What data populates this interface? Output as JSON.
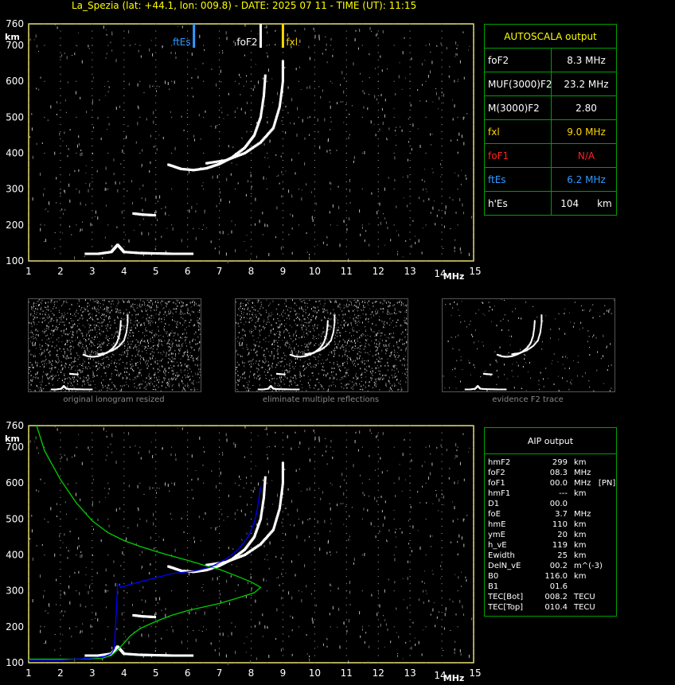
{
  "header": "La_Spezia (lat: +44.1, lon: 009.8) - DATE: 2025 07 11 - TIME (UT): 11:15",
  "autoscala": {
    "title": "AUTOSCALA output",
    "rows": [
      {
        "label": "foF2",
        "value": "8.3 MHz",
        "color": "#ffffff"
      },
      {
        "label": "MUF(3000)F2",
        "value": "23.2 MHz",
        "color": "#ffffff"
      },
      {
        "label": "M(3000)F2",
        "value": "2.80",
        "color": "#ffffff"
      },
      {
        "label": "fxl",
        "value": "9.0 MHz",
        "color": "#ffd700"
      },
      {
        "label": "foF1",
        "value": "N/A",
        "color": "#ff2020"
      },
      {
        "label": "ftEs",
        "value": "6.2 MHz",
        "color": "#3399ff"
      },
      {
        "label": "h'Es",
        "value": "104",
        "unit": "km",
        "color": "#ffffff"
      }
    ]
  },
  "aip": {
    "title": "AIP output",
    "rows": [
      [
        "hmF2",
        "299",
        "km"
      ],
      [
        "foF2",
        "08.3",
        "MHz"
      ],
      [
        "foF1",
        "00.0",
        "MHz   [PN]"
      ],
      [
        "hmF1",
        "---",
        "km"
      ],
      [
        "D1",
        "00.0",
        ""
      ],
      [
        "foE",
        "3.7",
        "MHz"
      ],
      [
        "hmE",
        "110",
        "km"
      ],
      [
        "ymE",
        "20",
        "km"
      ],
      [
        "h_vE",
        "119",
        "km"
      ],
      [
        "Ewidth",
        "25",
        "km"
      ],
      [
        "DelN_vE",
        "00.2",
        "m^(-3)"
      ],
      [
        "B0",
        "116.0",
        "km"
      ],
      [
        "B1",
        "01.6",
        ""
      ],
      [
        "TEC[Bot]",
        "008.2",
        "TECU"
      ],
      [
        "TEC[Top]",
        "010.4",
        "TECU"
      ]
    ]
  },
  "thumbnails": [
    "original ionogram resized",
    "eliminate multiple reflections",
    "evidence F2 trace"
  ],
  "chart_data": [
    {
      "type": "scatter",
      "title": "",
      "xlabel": "MHz",
      "ylabel": "km",
      "xlim": [
        1,
        15
      ],
      "ylim": [
        100,
        760
      ],
      "xticks": [
        1,
        2,
        3,
        4,
        5,
        6,
        7,
        8,
        9,
        10,
        11,
        12,
        13,
        14,
        15
      ],
      "yticks": [
        100,
        200,
        300,
        400,
        500,
        600,
        700,
        760
      ],
      "markers": [
        {
          "name": "ftEs",
          "x": 6.2,
          "color": "#3399ff"
        },
        {
          "name": "foF2",
          "x": 8.3,
          "color": "#ffffff"
        },
        {
          "name": "fxl",
          "x": 9.0,
          "color": "#ffd700"
        }
      ],
      "series": [
        {
          "color": "#ffffff",
          "points": [
            [
              2.8,
              120
            ],
            [
              3.2,
              120
            ],
            [
              3.6,
              125
            ],
            [
              3.8,
              145
            ],
            [
              4.0,
              125
            ],
            [
              4.5,
              122
            ],
            [
              5.0,
              121
            ],
            [
              5.5,
              120
            ],
            [
              6.2,
              120
            ]
          ]
        },
        {
          "color": "#ffffff",
          "points": [
            [
              4.3,
              232
            ],
            [
              4.6,
              229
            ],
            [
              5.0,
              227
            ]
          ]
        },
        {
          "color": "#ffffff",
          "points": [
            [
              5.4,
              368
            ],
            [
              5.8,
              356
            ],
            [
              6.2,
              353
            ],
            [
              6.6,
              358
            ],
            [
              7.0,
              370
            ],
            [
              7.4,
              388
            ],
            [
              7.8,
              415
            ],
            [
              8.1,
              450
            ],
            [
              8.3,
              500
            ],
            [
              8.4,
              560
            ],
            [
              8.45,
              620
            ]
          ]
        },
        {
          "color": "#ffffff",
          "points": [
            [
              6.6,
              372
            ],
            [
              7.2,
              380
            ],
            [
              7.8,
              400
            ],
            [
              8.3,
              430
            ],
            [
              8.7,
              470
            ],
            [
              8.9,
              530
            ],
            [
              9.0,
              600
            ],
            [
              9.0,
              660
            ]
          ]
        }
      ]
    },
    {
      "type": "line",
      "title": "",
      "xlabel": "MHz",
      "ylabel": "km",
      "xlim": [
        1,
        15
      ],
      "ylim": [
        100,
        760
      ],
      "xticks": [
        1,
        2,
        3,
        4,
        5,
        6,
        7,
        8,
        9,
        10,
        11,
        12,
        13,
        14,
        15
      ],
      "yticks": [
        100,
        200,
        300,
        400,
        500,
        600,
        700,
        760
      ],
      "series": [
        {
          "color": "#ffffff",
          "points": [
            [
              2.8,
              120
            ],
            [
              3.2,
              120
            ],
            [
              3.6,
              125
            ],
            [
              3.8,
              145
            ],
            [
              4.0,
              125
            ],
            [
              4.5,
              122
            ],
            [
              5.0,
              121
            ],
            [
              5.5,
              120
            ],
            [
              6.2,
              120
            ]
          ]
        },
        {
          "color": "#ffffff",
          "points": [
            [
              4.3,
              232
            ],
            [
              4.6,
              229
            ],
            [
              5.0,
              227
            ]
          ]
        },
        {
          "color": "#ffffff",
          "points": [
            [
              5.4,
              368
            ],
            [
              5.8,
              356
            ],
            [
              6.2,
              353
            ],
            [
              6.6,
              358
            ],
            [
              7.0,
              370
            ],
            [
              7.4,
              388
            ],
            [
              7.8,
              415
            ],
            [
              8.1,
              450
            ],
            [
              8.3,
              500
            ],
            [
              8.4,
              560
            ],
            [
              8.45,
              620
            ]
          ]
        },
        {
          "color": "#ffffff",
          "points": [
            [
              6.6,
              372
            ],
            [
              7.2,
              380
            ],
            [
              7.8,
              400
            ],
            [
              8.3,
              430
            ],
            [
              8.7,
              470
            ],
            [
              8.9,
              530
            ],
            [
              9.0,
              600
            ],
            [
              9.0,
              660
            ]
          ]
        },
        {
          "color": "#00d000",
          "points": [
            [
              1.25,
              760
            ],
            [
              1.5,
              690
            ],
            [
              2,
              610
            ],
            [
              2.5,
              545
            ],
            [
              3,
              495
            ],
            [
              3.5,
              462
            ],
            [
              4,
              440
            ],
            [
              4.5,
              424
            ],
            [
              5,
              410
            ],
            [
              5.5,
              397
            ],
            [
              6,
              385
            ],
            [
              6.5,
              372
            ],
            [
              7,
              360
            ],
            [
              7.5,
              343
            ],
            [
              8,
              325
            ],
            [
              8.3,
              310
            ],
            [
              8.1,
              295
            ],
            [
              7.5,
              278
            ],
            [
              7,
              265
            ],
            [
              6.5,
              255
            ],
            [
              6,
              245
            ],
            [
              5.5,
              232
            ],
            [
              5,
              215
            ],
            [
              4.5,
              195
            ],
            [
              4.2,
              175
            ],
            [
              4.0,
              155
            ],
            [
              3.8,
              135
            ],
            [
              3.6,
              120
            ],
            [
              3.3,
              112
            ],
            [
              2.5,
              110
            ],
            [
              1,
              110
            ]
          ]
        },
        {
          "color": "#0000ff",
          "points": [
            [
              1,
              107
            ],
            [
              2,
              107
            ],
            [
              2.5,
              110
            ],
            [
              3,
              113
            ],
            [
              3.4,
              118
            ],
            [
              3.6,
              125
            ],
            [
              3.7,
              140
            ],
            [
              3.8,
              320
            ],
            [
              3.9,
              310
            ],
            [
              4.2,
              318
            ],
            [
              4.8,
              332
            ],
            [
              5.5,
              348
            ],
            [
              6.2,
              355
            ],
            [
              6.7,
              365
            ],
            [
              7.2,
              388
            ],
            [
              7.6,
              415
            ],
            [
              7.9,
              450
            ],
            [
              8.1,
              490
            ],
            [
              8.2,
              530
            ],
            [
              8.3,
              590
            ]
          ]
        }
      ]
    }
  ]
}
